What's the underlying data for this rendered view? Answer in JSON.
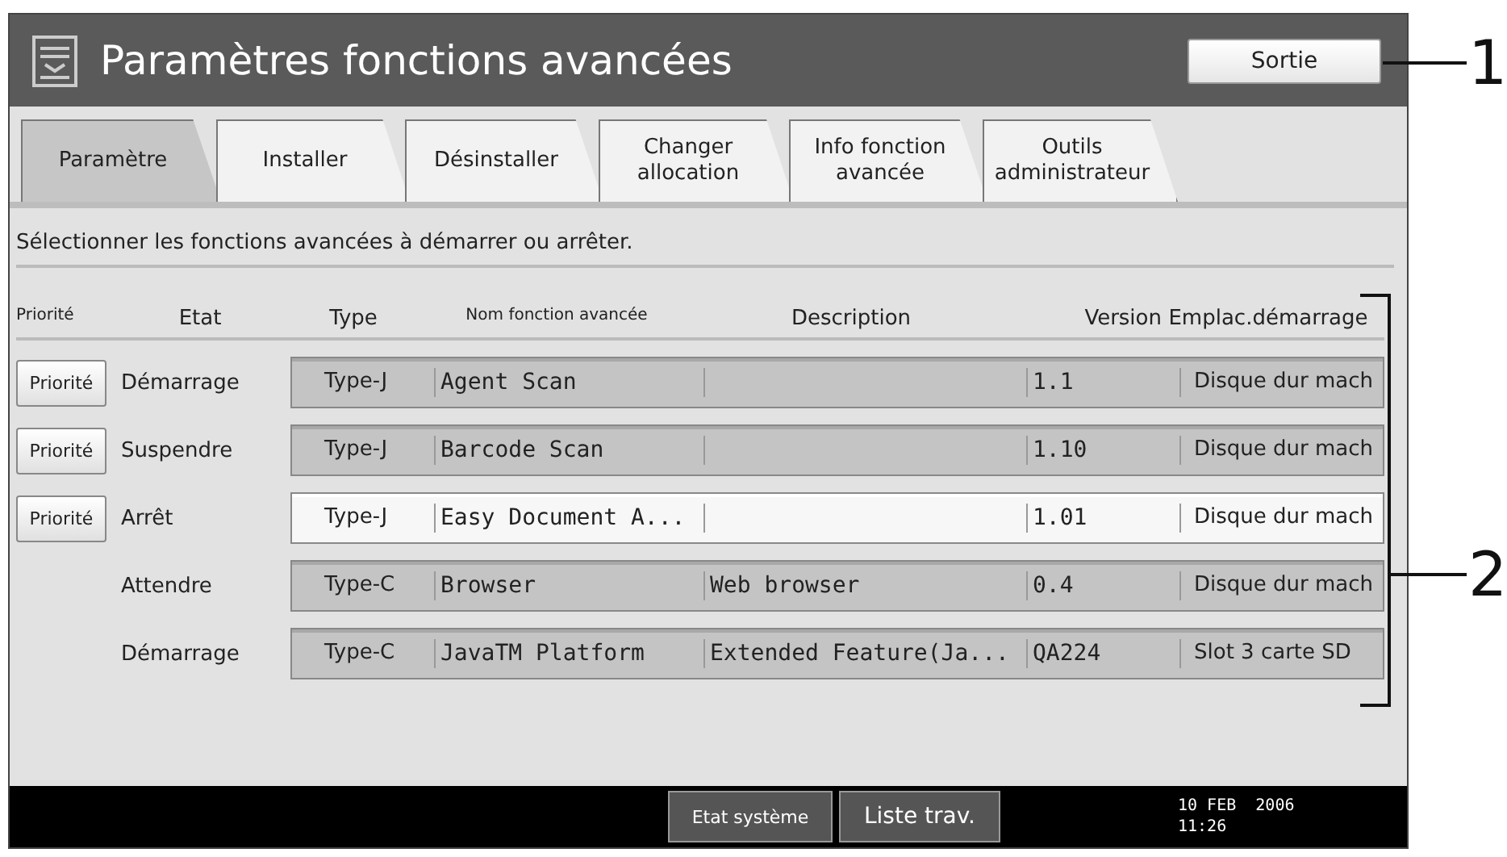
{
  "window": {
    "title": "Paramètres fonctions avancées"
  },
  "exit_button": "Sortie",
  "tabs": [
    {
      "label": "Paramètre",
      "selected": true
    },
    {
      "label": "Installer",
      "selected": false
    },
    {
      "label": "Désinstaller",
      "selected": false
    },
    {
      "label": "Changer allocation",
      "selected": false
    },
    {
      "label": "Info fonction avancée",
      "selected": false
    },
    {
      "label": "Outils administrateur",
      "selected": false
    }
  ],
  "instruction": "Sélectionner les fonctions avancées à démarrer ou arrêter.",
  "table": {
    "columns": [
      "Priorité",
      "Etat",
      "Type",
      "Nom fonction avancée",
      "Description",
      "Version",
      "Emplac.démarrage"
    ],
    "rows": [
      {
        "priority_button": "Priorité",
        "state": "Démarrage",
        "type": "Type-J",
        "name": "Agent Scan",
        "version": "1.1",
        "location": "Disque dur mach",
        "selected": false
      },
      {
        "priority_button": "Priorité",
        "state": "Suspendre",
        "type": "Type-J",
        "name": "Barcode Scan",
        "version": "1.10",
        "location": "Disque dur mach",
        "selected": false
      },
      {
        "priority_button": "Priorité",
        "state": "Arrêt",
        "type": "Type-J",
        "name": "Easy Document A...",
        "version": "1.01",
        "location": "Disque dur mach",
        "selected": true
      },
      {
        "state": "Attendre",
        "type": "Type-C",
        "name": "Browser",
        "description": "Web browser",
        "version": "0.4",
        "location": "Disque dur mach",
        "selected": false
      },
      {
        "state": "Démarrage",
        "type": "Type-C",
        "name": "JavaTM Platform",
        "description": "Extended Feature(Ja...",
        "version": "QA224",
        "location": "Slot 3 carte SD",
        "selected": false
      }
    ]
  },
  "status_bar": {
    "buttons": [
      "Etat système",
      "Liste trav."
    ],
    "date": "10 FEB  2006",
    "time": "11:26"
  },
  "callouts": [
    "1",
    "2"
  ]
}
